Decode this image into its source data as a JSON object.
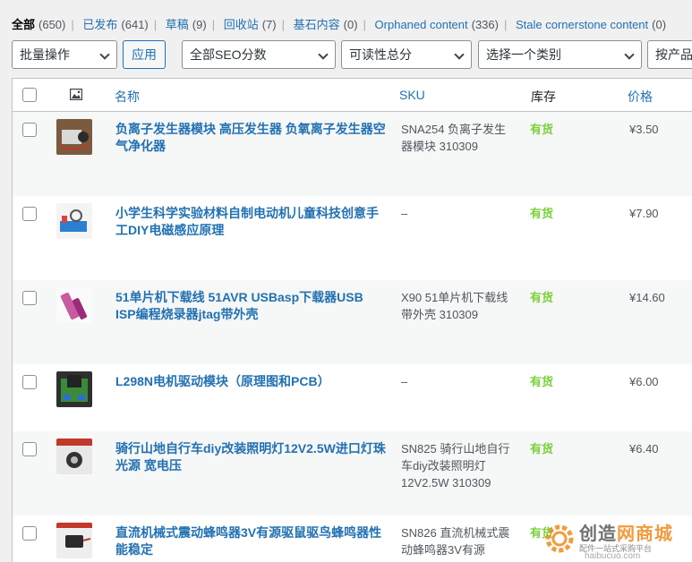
{
  "filters": [
    {
      "label": "全部",
      "count": "(650)",
      "current": true
    },
    {
      "label": "已发布",
      "count": "(641)",
      "current": false
    },
    {
      "label": "草稿",
      "count": "(9)",
      "current": false
    },
    {
      "label": "回收站",
      "count": "(7)",
      "current": false
    },
    {
      "label": "基石内容",
      "count": "(0)",
      "current": false
    },
    {
      "label": "Orphaned content",
      "count": "(336)",
      "current": false
    },
    {
      "label": "Stale cornerstone content",
      "count": "(0)",
      "current": false
    }
  ],
  "toolbar": {
    "bulk_action": "批量操作",
    "apply_label": "应用",
    "seo_filter": "全部SEO分数",
    "readability_filter": "可读性总分",
    "category_filter": "选择一个类别",
    "product_type_filter": "按产品"
  },
  "columns": {
    "thumb_icon": "image-icon",
    "name": "名称",
    "sku": "SKU",
    "stock": "库存",
    "price": "价格"
  },
  "rows": [
    {
      "name": "负离子发生器模块 高压发生器 负氧离子发生器空气净化器",
      "sku": "SNA254 负离子发生器模块 310309",
      "stock": "有货",
      "price": "¥3.50",
      "thumb_color": "#8a6a4a"
    },
    {
      "name": "小学生科学实验材料自制电动机儿童科技创意手工DIY电磁感应原理",
      "sku": "–",
      "stock": "有货",
      "price": "¥7.90",
      "thumb_color": "#2a7fd0"
    },
    {
      "name": "51单片机下载线 51AVR USBasp下载器USB ISP编程烧录器jtag带外壳",
      "sku": "X90 51单片机下载线带外壳 310309",
      "stock": "有货",
      "price": "¥14.60",
      "thumb_color": "#c85aa0"
    },
    {
      "name": "L298N电机驱动模块（原理图和PCB）",
      "sku": "–",
      "stock": "有货",
      "price": "¥6.00",
      "thumb_color": "#3a8a3a"
    },
    {
      "name": "骑行山地自行车diy改装照明灯12V2.5W进口灯珠光源 宽电压",
      "sku": "SN825 骑行山地自行车diy改装照明灯12V2.5W 310309",
      "stock": "有货",
      "price": "¥6.40",
      "thumb_color": "#444444"
    },
    {
      "name": "直流机械式震动蜂鸣器3V有源驱鼠驱鸟蜂鸣器性能稳定",
      "sku": "SN826 直流机械式震动蜂鸣器3V有源",
      "stock": "有货",
      "price": "",
      "thumb_color": "#333333"
    }
  ],
  "watermark": {
    "title_a": "创造",
    "title_b": "网",
    "title_c": "商城",
    "subtitle": "配件一站式采购平台",
    "url": "haibucuo.com"
  },
  "colors": {
    "link": "#2271b1",
    "in_stock": "#7ad03a",
    "watermark_accent": "#f08a1c"
  }
}
